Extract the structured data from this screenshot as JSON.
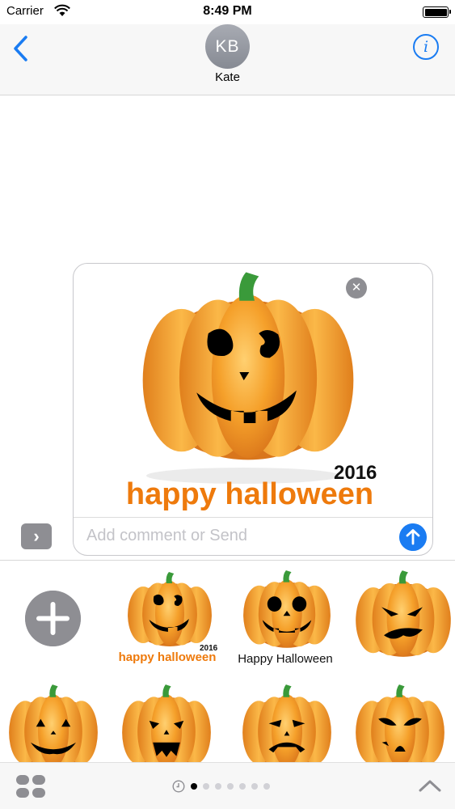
{
  "status_bar": {
    "carrier": "Carrier",
    "time": "8:49 PM"
  },
  "nav": {
    "avatar_initials": "KB",
    "contact_name": "Kate",
    "info_label": "i"
  },
  "compose": {
    "placeholder": "Add comment or Send",
    "sticker": {
      "year": "2016",
      "caption": "happy halloween"
    },
    "remove_label": "✕",
    "expand_label": "›"
  },
  "drawer": {
    "stickers": [
      {
        "name": "happy-halloween-2016",
        "caption": "happy halloween",
        "year": "2016"
      },
      {
        "name": "happy-halloween-jack-o-lantern",
        "caption": "Happy Halloween"
      },
      {
        "name": "angry-pumpkin"
      },
      {
        "name": "smiling-pumpkin"
      },
      {
        "name": "scary-pumpkin"
      },
      {
        "name": "sad-pumpkin"
      },
      {
        "name": "evil-pumpkin"
      }
    ]
  },
  "colors": {
    "accent": "#1a7cf2",
    "pumpkin": "#f29a1b",
    "stem": "#3a9a3a",
    "caption": "#ee7a0c",
    "gray_button": "#8e8e93"
  },
  "bottom_bar": {
    "page_count": 8,
    "active_page": 1
  }
}
